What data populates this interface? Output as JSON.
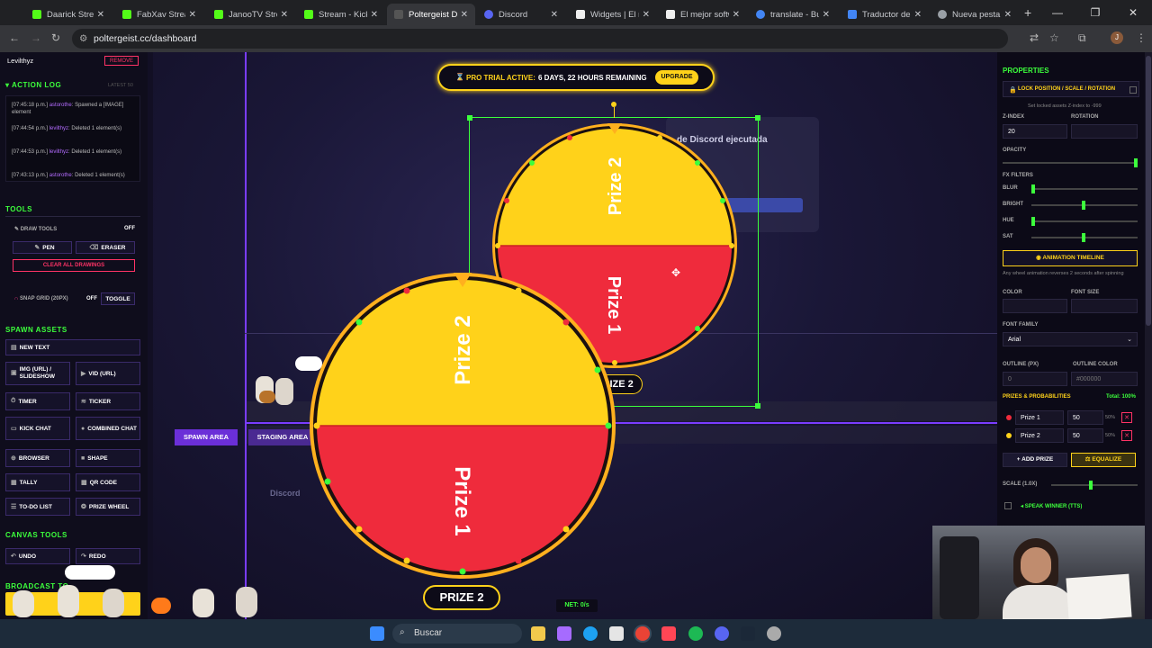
{
  "browser": {
    "tabs": [
      {
        "title": "Daarick Stream",
        "color": "#53fc18"
      },
      {
        "title": "FabXav Stream",
        "color": "#53fc18"
      },
      {
        "title": "JanooTV Stream",
        "color": "#53fc18"
      },
      {
        "title": "Stream - Kick D",
        "color": "#53fc18"
      },
      {
        "title": "Poltergeist Das",
        "color": "#3b3b3b"
      },
      {
        "title": "Discord",
        "color": "#5865f2"
      },
      {
        "title": "Widgets | El m",
        "color": "#eeeeee"
      },
      {
        "title": "El mejor softw",
        "color": "#eeeeee"
      },
      {
        "title": "translate - Bus",
        "color": "#4285f4"
      },
      {
        "title": "Traductor de G",
        "color": "#4285f4"
      },
      {
        "title": "Nueva pestaña",
        "color": "#9aa0a6"
      }
    ],
    "url": "poltergeist.cc/dashboard",
    "profile_initial": "J"
  },
  "left": {
    "user": "Levilthyz",
    "user_action": "REMOVE",
    "action_log_title": "ACTION LOG",
    "action_log_badge": "LATEST 50",
    "log": [
      {
        "time": "[07:45:18 p.m.]",
        "user": "astorothe",
        "text": "Spawned a [IMAGE] element"
      },
      {
        "time": "[07:44:54 p.m.]",
        "user": "levilthyz",
        "text": "Deleted 1 element(s)"
      },
      {
        "time": "[07:44:53 p.m.]",
        "user": "levilthyz",
        "text": "Deleted 1 element(s)"
      },
      {
        "time": "[07:43:13 p.m.]",
        "user": "astorothe",
        "text": "Deleted 1 element(s)"
      }
    ],
    "tools_title": "TOOLS",
    "draw_tools": "DRAW TOOLS",
    "draw_tools_state": "OFF",
    "pen": "PEN",
    "eraser": "ERASER",
    "clear": "CLEAR ALL DRAWINGS",
    "snap": "SNAP GRID (20PX)",
    "snap_state": "OFF",
    "toggle": "TOGGLE",
    "spawn_title": "SPAWN ASSETS",
    "new_text": "NEW TEXT",
    "img": "IMG (URL) / SLIDESHOW",
    "vid": "VID (URL)",
    "timer": "TIMER",
    "ticker": "TICKER",
    "kick_chat": "KICK CHAT",
    "combined_chat": "COMBINED CHAT",
    "browser": "BROWSER",
    "shape": "SHAPE",
    "tally": "TALLY",
    "qr": "QR CODE",
    "todo": "TO-DO LIST",
    "prize_wheel": "PRIZE WHEEL",
    "canvas_tools_title": "CANVAS TOOLS",
    "undo": "UNDO",
    "redo": "REDO",
    "broadcast": "BROADCAST TO"
  },
  "canvas": {
    "trial_text": "PRO TRIAL ACTIVE:",
    "trial_remaining": "6 DAYS, 22 HOURS REMAINING",
    "upgrade": "UPGRADE",
    "spawn_area": "SPAWN AREA",
    "staging_area": "STAGING AREA",
    "net": "NET: 0/s",
    "discord_title": "de Discord ejecutada",
    "wheel_big_label": "PRIZE 2",
    "wheel_small_label": "PRIZE 2",
    "prize1": "Prize 1",
    "prize2": "Prize 2"
  },
  "right": {
    "title": "PROPERTIES",
    "lock": "LOCK POSITION / SCALE / ROTATION",
    "lock_hint": "Set locked assets Z-index to -999",
    "zindex_label": "Z-INDEX",
    "zindex": "20",
    "rotation_label": "ROTATION",
    "opacity_label": "OPACITY",
    "fx_label": "FX FILTERS",
    "blur": "BLUR",
    "bright": "BRIGHT",
    "hue": "HUE",
    "sat": "SAT",
    "anim": "ANIMATION TIMELINE",
    "anim_hint": "Any wheel animation reverses 2 seconds after spinning",
    "color_label": "COLOR",
    "font_size_label": "FONT SIZE",
    "font_family_label": "FONT FAMILY",
    "font_family": "Arial",
    "outline_px_label": "OUTLINE (PX)",
    "outline_px": "0",
    "outline_color_label": "OUTLINE COLOR",
    "outline_color": "#000000",
    "prizes_label": "PRIZES & PROBABILITIES",
    "total": "Total: 100%",
    "prizes": [
      {
        "name": "Prize 1",
        "weight": "50",
        "pct": "50%",
        "color": "#ef2b3c"
      },
      {
        "name": "Prize 2",
        "weight": "50",
        "pct": "50%",
        "color": "#ffd21a"
      }
    ],
    "add_prize": "+ ADD PRIZE",
    "equalize": "EQUALIZE",
    "scale_label": "SCALE (1.0X)",
    "speak_winner": "SPEAK WINNER (TTS)"
  },
  "taskbar": {
    "search": "Buscar"
  }
}
